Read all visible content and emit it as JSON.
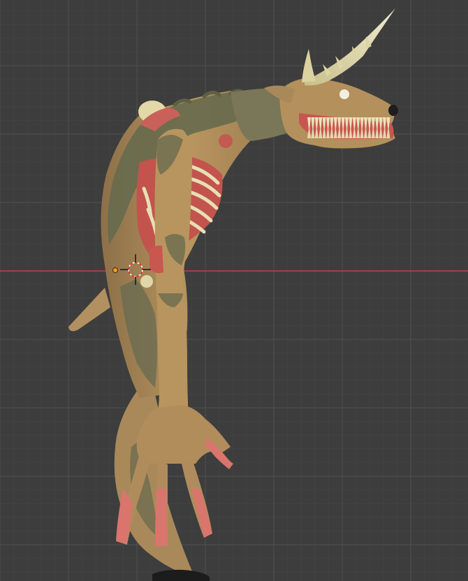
{
  "app": {
    "name": "",
    "view": "3D Viewport",
    "background": "#3d3d3d"
  },
  "viewport": {
    "grid": {
      "minor_color": "#454545",
      "major_color": "#4e4e4e",
      "x_axis_color": "#b5454b",
      "visible": true
    },
    "object": {
      "name": "",
      "icon": "creature-sculpt",
      "palette": {
        "skin": "#b2905e",
        "skin_dark": "#8d7049",
        "moss": "#6b6b4f",
        "flesh": "#c8574f",
        "bone": "#e6ddb0",
        "claw": "#d9756c",
        "nose": "#1e1e1e"
      }
    },
    "cursor_3d": {
      "icon": "3d-cursor-icon"
    },
    "origin_point": {
      "icon": "object-origin-icon",
      "color": "#ff9a1a"
    }
  }
}
